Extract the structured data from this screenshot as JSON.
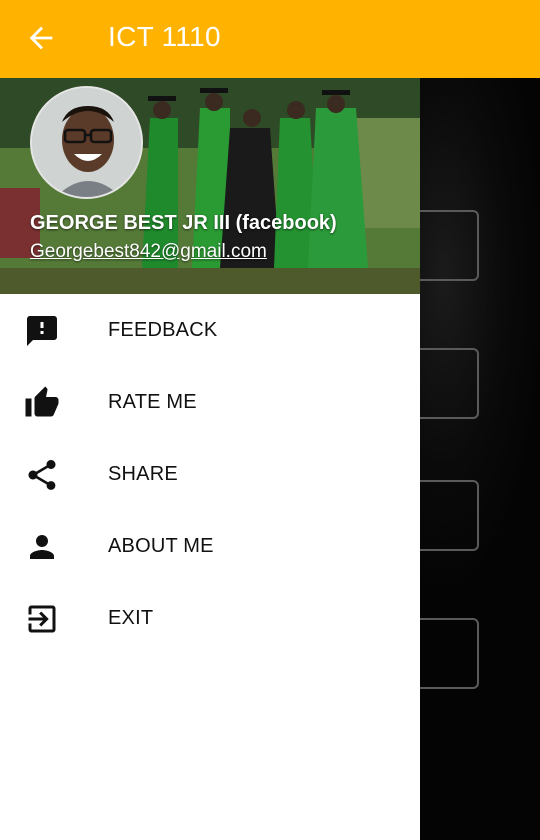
{
  "appbar": {
    "title": "ICT 1110"
  },
  "user": {
    "name": "GEORGE BEST JR III (facebook)",
    "email": "Georgebest842@gmail.com"
  },
  "menu": {
    "items": [
      {
        "label": "FEEDBACK",
        "icon": "feedback-icon"
      },
      {
        "label": "RATE ME",
        "icon": "thumb-up-icon"
      },
      {
        "label": "SHARE",
        "icon": "share-icon"
      },
      {
        "label": "ABOUT ME",
        "icon": "person-icon"
      },
      {
        "label": "EXIT",
        "icon": "exit-icon"
      }
    ]
  },
  "colors": {
    "appbar": "#FFB300",
    "drawer": "#FFFFFF",
    "scrim": "#000000"
  }
}
